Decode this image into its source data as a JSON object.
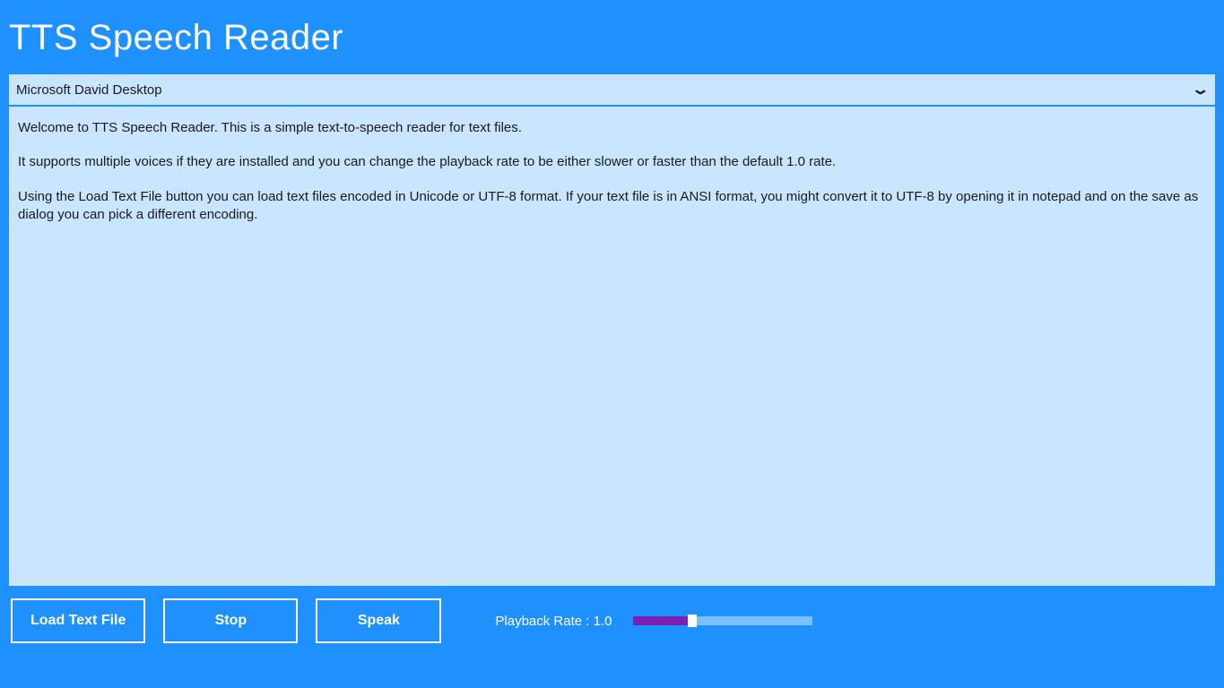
{
  "app": {
    "title": "TTS Speech Reader"
  },
  "voice": {
    "selected": "Microsoft David Desktop"
  },
  "text": {
    "p1": "Welcome to TTS Speech Reader.  This is a simple text-to-speech reader for text files.",
    "p2": "It supports multiple voices if they are installed and you can change the playback rate to be either slower or faster than the default 1.0 rate.",
    "p3": "Using the Load Text File button you can load text files encoded in Unicode or UTF-8 format.  If your text file is in ANSI format, you might convert it to UTF-8 by opening it in notepad and on the save as dialog you can pick a different encoding."
  },
  "controls": {
    "load_label": "Load Text File",
    "stop_label": "Stop",
    "speak_label": "Speak",
    "rate_label": "Playback Rate : 1.0",
    "rate_value": 1.0,
    "rate_min": 0.0,
    "rate_max": 3.0,
    "slider_fill_percent": "33%"
  },
  "colors": {
    "primary_bg": "#1e90ff",
    "panel_bg": "#c9e5ff",
    "slider_fill": "#7a1fb0",
    "slider_track": "#78c0ff",
    "text_on_primary": "#ffffff",
    "text_on_panel": "#1a1a1a"
  }
}
